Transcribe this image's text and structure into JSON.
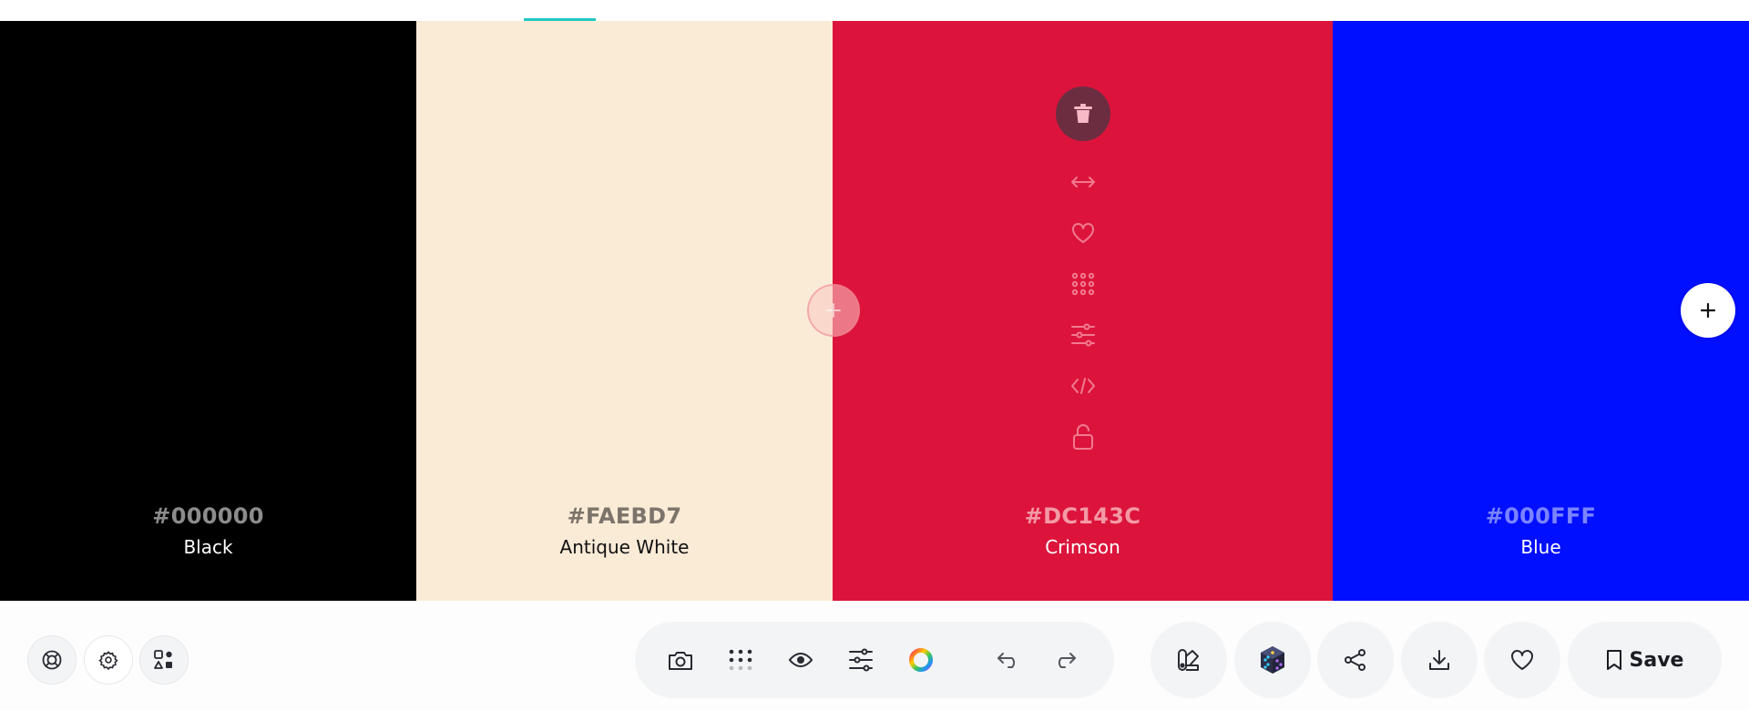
{
  "palette": {
    "colors": [
      {
        "hex": "#000000",
        "name": "Black",
        "hex_color": "#8c8c8c",
        "name_color": "#ffffff"
      },
      {
        "hex": "#FAEBD7",
        "name": "Antique White",
        "hex_color": "#7c746a",
        "name_color": "#111111"
      },
      {
        "hex": "#DC143C",
        "name": "Crimson",
        "hex_color": "#f39aa6",
        "name_color": "#ffffff"
      },
      {
        "hex": "#000FFF",
        "name": "Blue",
        "hex_color": "#7a84ff",
        "name_color": "#ffffff"
      }
    ]
  },
  "swatch_tools": [
    "trash-icon",
    "drag-arrows-icon",
    "heart-icon",
    "shades-grid-icon",
    "adjust-sliders-icon",
    "code-icon",
    "lock-icon"
  ],
  "toolbar": {
    "left_buttons": [
      "help-lifebuoy-icon",
      "settings-gear-icon",
      "shapes-icon"
    ],
    "center_tools": [
      "camera-icon",
      "grid-dots-icon",
      "eye-icon",
      "sliders-icon",
      "color-wheel-icon",
      "undo-icon",
      "redo-icon"
    ],
    "right_buttons": [
      "palette-swatches-icon",
      "random-dice-icon",
      "share-icon",
      "download-icon",
      "heart-icon"
    ],
    "save_label": "Save"
  },
  "colors": {
    "accent": "#22c7c2",
    "toolbar_bg": "#f3f4f6",
    "trash_bg": "#6d2d41"
  }
}
